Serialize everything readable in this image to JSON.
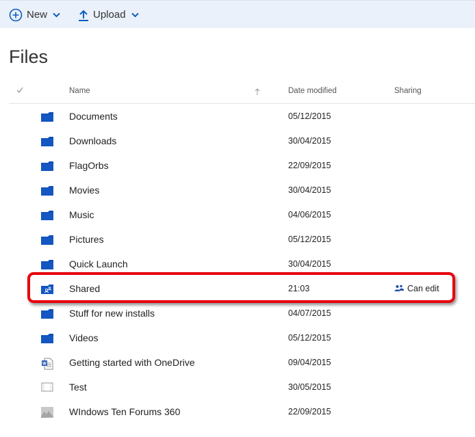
{
  "toolbar": {
    "new_label": "New",
    "upload_label": "Upload",
    "accent": "#0f5cbf"
  },
  "page_title": "Files",
  "columns": {
    "name": "Name",
    "date": "Date modified",
    "sharing": "Sharing"
  },
  "files": [
    {
      "name": "Documents",
      "date": "05/12/2015",
      "sharing": "",
      "icon": "folder-icon"
    },
    {
      "name": "Downloads",
      "date": "30/04/2015",
      "sharing": "",
      "icon": "folder-icon"
    },
    {
      "name": "FlagOrbs",
      "date": "22/09/2015",
      "sharing": "",
      "icon": "folder-icon"
    },
    {
      "name": "Movies",
      "date": "30/04/2015",
      "sharing": "",
      "icon": "folder-icon"
    },
    {
      "name": "Music",
      "date": "04/06/2015",
      "sharing": "",
      "icon": "folder-icon"
    },
    {
      "name": "Pictures",
      "date": "05/12/2015",
      "sharing": "",
      "icon": "folder-icon"
    },
    {
      "name": "Quick Launch",
      "date": "30/04/2015",
      "sharing": "",
      "icon": "folder-icon"
    },
    {
      "name": "Shared",
      "date": "21:03",
      "sharing": "Can edit",
      "icon": "shared-folder-icon"
    },
    {
      "name": "Stuff for new installs",
      "date": "04/07/2015",
      "sharing": "",
      "icon": "folder-icon"
    },
    {
      "name": "Videos",
      "date": "05/12/2015",
      "sharing": "",
      "icon": "folder-icon"
    },
    {
      "name": "Getting started with OneDrive",
      "date": "09/04/2015",
      "sharing": "",
      "icon": "word-document-icon"
    },
    {
      "name": "Test",
      "date": "30/05/2015",
      "sharing": "",
      "icon": "generic-file-icon"
    },
    {
      "name": "WIndows Ten Forums 360",
      "date": "22/09/2015",
      "sharing": "",
      "icon": "image-file-icon"
    }
  ]
}
